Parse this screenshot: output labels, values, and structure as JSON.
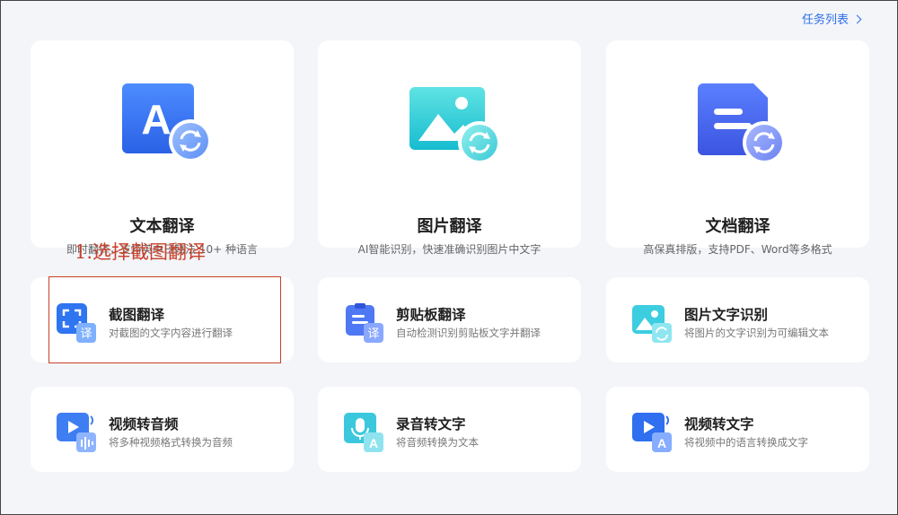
{
  "header": {
    "task_list_label": "任务列表"
  },
  "main_cards": [
    {
      "title": "文本翻译",
      "desc": "即时翻译，支持英中日韩法 10+ 种语言",
      "icon": "text-translate-icon"
    },
    {
      "title": "图片翻译",
      "desc": "AI智能识别，快速准确识别图片中文字",
      "icon": "image-translate-icon"
    },
    {
      "title": "文档翻译",
      "desc": "高保真排版，支持PDF、Word等多格式",
      "icon": "document-translate-icon"
    }
  ],
  "tool_cards": [
    {
      "title": "截图翻译",
      "desc": "对截图的文字内容进行翻译",
      "icon": "screenshot-translate-icon"
    },
    {
      "title": "剪贴板翻译",
      "desc": "自动检测识别剪贴板文字并翻译",
      "icon": "clipboard-translate-icon"
    },
    {
      "title": "图片文字识别",
      "desc": "将图片的文字识别为可编辑文本",
      "icon": "image-ocr-icon"
    },
    {
      "title": "视频转音频",
      "desc": "将多种视频格式转换为音频",
      "icon": "video-to-audio-icon"
    },
    {
      "title": "录音转文字",
      "desc": "将音频转换为文本",
      "icon": "audio-to-text-icon"
    },
    {
      "title": "视频转文字",
      "desc": "将视频中的语言转换成文字",
      "icon": "video-to-text-icon"
    }
  ],
  "annotation": {
    "text": "1.选择截图翻译"
  },
  "colors": {
    "accent": "#2d6ee8",
    "annotation": "#c8402a",
    "background": "#f3f5f9"
  }
}
